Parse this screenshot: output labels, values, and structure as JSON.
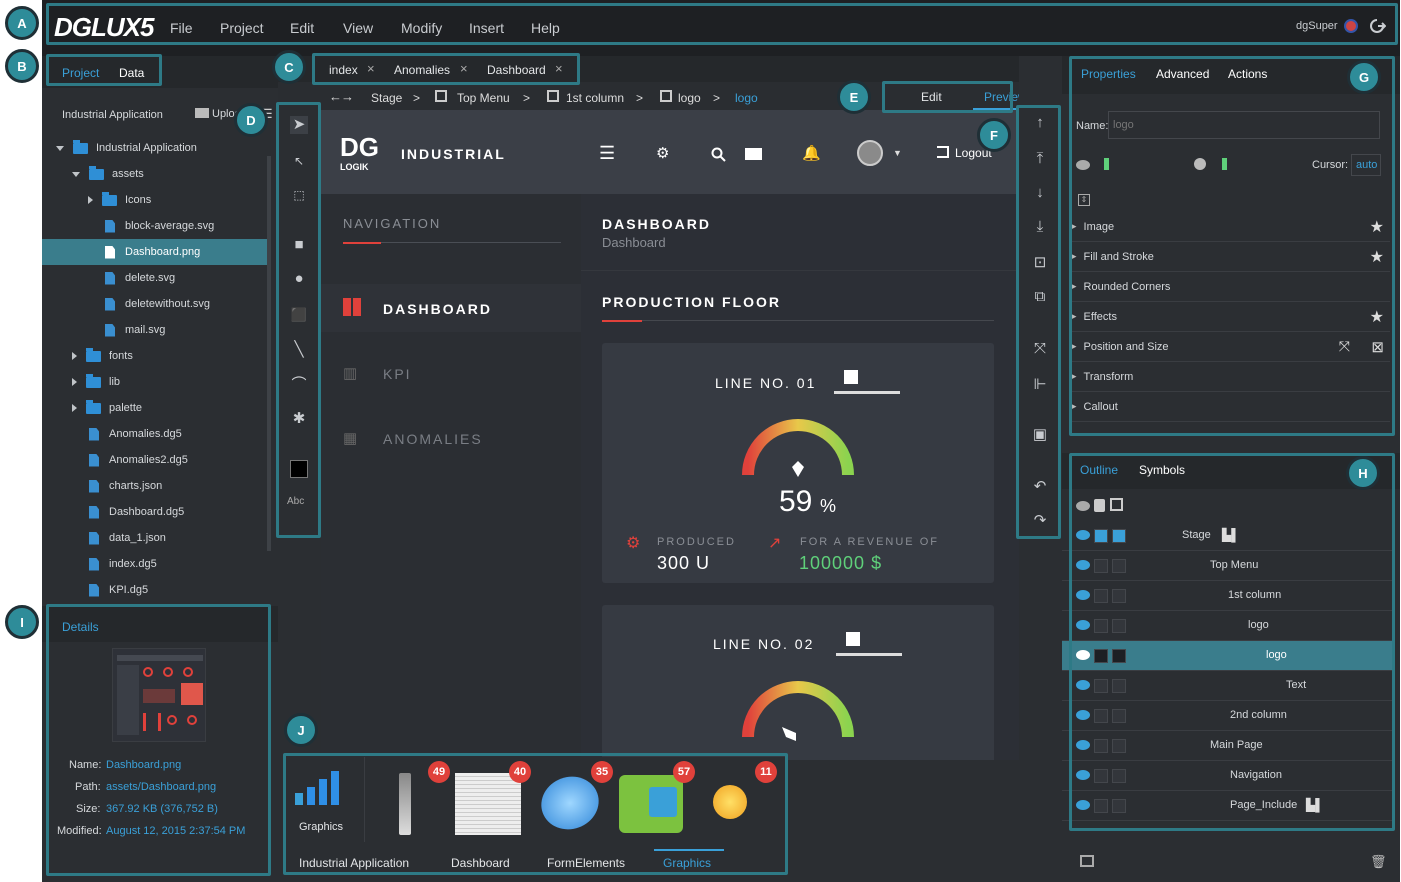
{
  "menubar": {
    "logo": "DGLUX5",
    "items": [
      "File",
      "Project",
      "Edit",
      "View",
      "Modify",
      "Insert",
      "Help"
    ],
    "user": "dgSuper"
  },
  "callouts": [
    "A",
    "B",
    "C",
    "D",
    "E",
    "F",
    "G",
    "H",
    "I",
    "J"
  ],
  "left_panel": {
    "tabs": [
      "Project",
      "Data"
    ],
    "project_name": "Industrial Application",
    "upload_label": "Upload",
    "tree": [
      {
        "label": "Industrial Application",
        "type": "folder",
        "depth": 0,
        "exp": "open"
      },
      {
        "label": "assets",
        "type": "folder",
        "depth": 1,
        "exp": "open"
      },
      {
        "label": "Icons",
        "type": "folder",
        "depth": 2,
        "exp": "closed"
      },
      {
        "label": "block-average.svg",
        "type": "file",
        "depth": 2,
        "exp": ""
      },
      {
        "label": "Dashboard.png",
        "type": "image",
        "depth": 2,
        "exp": "",
        "selected": true
      },
      {
        "label": "delete.svg",
        "type": "file",
        "depth": 2,
        "exp": ""
      },
      {
        "label": "deletewithout.svg",
        "type": "file",
        "depth": 2,
        "exp": ""
      },
      {
        "label": "mail.svg",
        "type": "file",
        "depth": 2,
        "exp": ""
      },
      {
        "label": "fonts",
        "type": "folder",
        "depth": 1,
        "exp": "closed"
      },
      {
        "label": "lib",
        "type": "folder",
        "depth": 1,
        "exp": "closed"
      },
      {
        "label": "palette",
        "type": "folder",
        "depth": 1,
        "exp": "closed"
      },
      {
        "label": "Anomalies.dg5",
        "type": "file",
        "depth": 1,
        "exp": ""
      },
      {
        "label": "Anomalies2.dg5",
        "type": "file",
        "depth": 1,
        "exp": ""
      },
      {
        "label": "charts.json",
        "type": "file",
        "depth": 1,
        "exp": ""
      },
      {
        "label": "Dashboard.dg5",
        "type": "file",
        "depth": 1,
        "exp": ""
      },
      {
        "label": "data_1.json",
        "type": "file",
        "depth": 1,
        "exp": ""
      },
      {
        "label": "index.dg5",
        "type": "file",
        "depth": 1,
        "exp": ""
      },
      {
        "label": "KPI.dg5",
        "type": "file",
        "depth": 1,
        "exp": ""
      }
    ],
    "details": {
      "tab": "Details",
      "name_label": "Name:",
      "name": "Dashboard.png",
      "path_label": "Path:",
      "path": "assets/Dashboard.png",
      "size_label": "Size:",
      "size": "367.92 KB (376,752 B)",
      "modified_label": "Modified:",
      "modified": "August 12, 2015 2:37:54 PM"
    }
  },
  "doc_tabs": [
    "index",
    "Anomalies",
    "Dashboard"
  ],
  "breadcrumb": {
    "back": "←",
    "forward": "→",
    "sep": ">",
    "items": [
      "Stage",
      "Top Menu",
      "1st column",
      "logo",
      "logo"
    ]
  },
  "mode": {
    "edit": "Edit",
    "preview": "Preview"
  },
  "stage": {
    "brand_line1": "DG",
    "brand_line2": "LOGIK",
    "brand_name": "INDUSTRIAL",
    "logout": "Logout",
    "nav_title": "NAVIGATION",
    "nav_items": [
      "DASHBOARD",
      "KPI",
      "ANOMALIES"
    ],
    "page_title": "DASHBOARD",
    "page_subtitle": "Dashboard",
    "section_title": "PRODUCTION FLOOR",
    "line1": {
      "title": "LINE NO. 01",
      "percent": "59",
      "percent_sign": "%",
      "produced_label": "PRODUCED",
      "produced": "300 U",
      "revenue_label": "FOR A REVENUE OF",
      "revenue": "100000 $"
    },
    "line2": {
      "title": "LINE NO. 02"
    }
  },
  "toolbar_left": {
    "text_tool": "Abc"
  },
  "properties": {
    "tabs": [
      "Properties",
      "Advanced",
      "Actions"
    ],
    "name_label": "Name:",
    "name_placeholder": "logo",
    "cursor_label": "Cursor:",
    "cursor_value": "auto",
    "sections": [
      "Image",
      "Fill and Stroke",
      "Rounded Corners",
      "Effects",
      "Position and Size",
      "Transform",
      "Callout"
    ]
  },
  "outline": {
    "tabs": [
      "Outline",
      "Symbols"
    ],
    "rows": [
      "Stage",
      "Top Menu",
      "1st column",
      "logo",
      "logo",
      "Text",
      "2nd column",
      "Main Page",
      "Navigation",
      "Page_Include"
    ]
  },
  "symbols": {
    "items": [
      {
        "label": "Graphics",
        "badge": ""
      },
      {
        "label": "",
        "badge": "49"
      },
      {
        "label": "",
        "badge": "40"
      },
      {
        "label": "",
        "badge": "35"
      },
      {
        "label": "",
        "badge": "57"
      },
      {
        "label": "",
        "badge": "11"
      }
    ],
    "tabs": [
      "Industrial Application",
      "Dashboard",
      "FormElements",
      "Graphics"
    ]
  },
  "colors": {
    "accent": "#3aa0d8",
    "highlight": "#2e7a86",
    "red": "#e0413b",
    "green": "#5fd07a"
  }
}
